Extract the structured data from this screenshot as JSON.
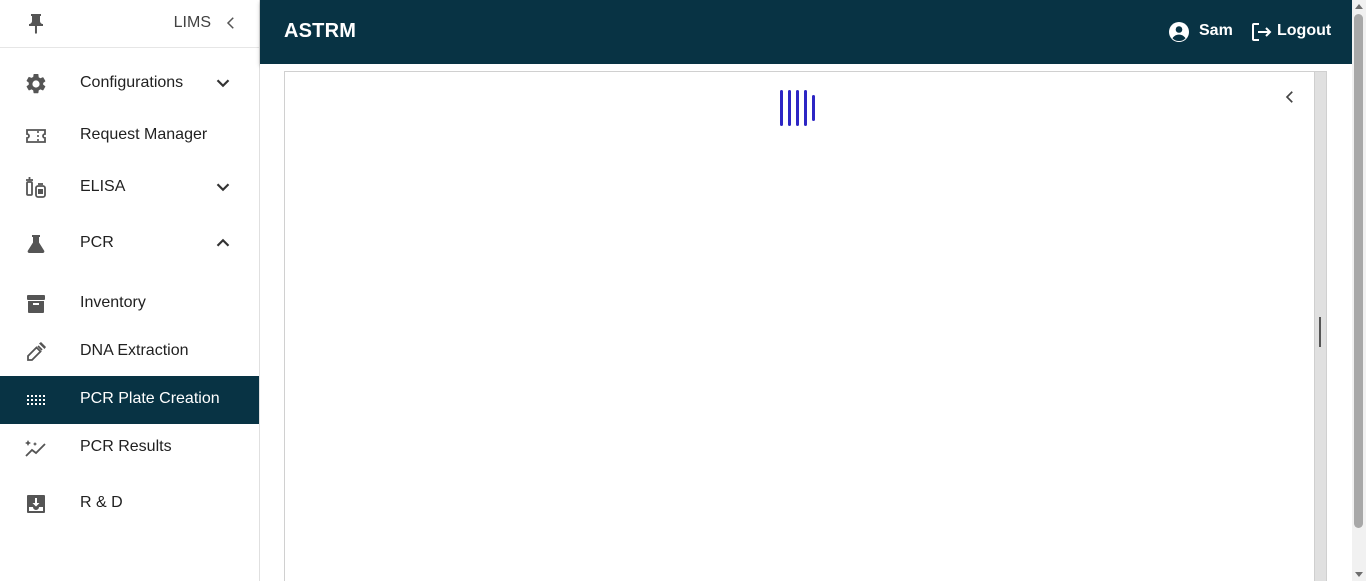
{
  "sidebar": {
    "brand": "LIMS",
    "items": [
      {
        "label": "Configurations",
        "icon": "gear-icon",
        "expandable": "chevron-down"
      },
      {
        "label": "Request Manager",
        "icon": "ticket-icon"
      },
      {
        "label": "ELISA",
        "icon": "vials-icon",
        "expandable": "chevron-down"
      },
      {
        "label": "PCR",
        "icon": "flask-icon",
        "expandable": "chevron-up"
      },
      {
        "label": "Inventory",
        "icon": "archive-icon"
      },
      {
        "label": "DNA Extraction",
        "icon": "pipette-icon"
      },
      {
        "label": "PCR Plate Creation",
        "icon": "grid-icon",
        "active": true
      },
      {
        "label": "PCR Results",
        "icon": "chart-sparkle-icon"
      },
      {
        "label": "R & D",
        "icon": "download-box-icon"
      }
    ]
  },
  "header": {
    "title": "ASTRM",
    "user": "Sam",
    "logout_label": "Logout"
  },
  "colors": {
    "primary": "#083344",
    "loader": "#2d26c4"
  }
}
